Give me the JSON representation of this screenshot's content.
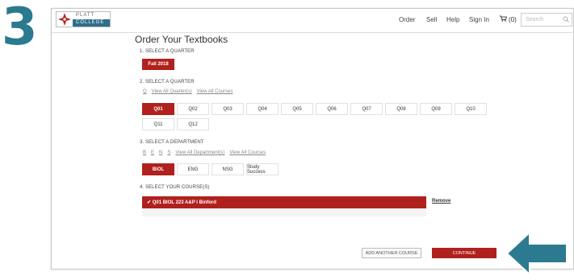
{
  "step_number": "3",
  "header": {
    "logo": {
      "top": "PLATT",
      "bottom": "COLLEGE"
    },
    "nav": {
      "order": "Order",
      "sell": "Sell",
      "help": "Help",
      "sign_in": "Sign In"
    },
    "cart_count": "(0)",
    "search_placeholder": "Search"
  },
  "page_title": "Order Your Textbooks",
  "section1": {
    "label": "1. SELECT A QUARTER",
    "selected": "Fall 2018"
  },
  "section2": {
    "label": "2. SELECT A QUARTER",
    "links": [
      "Q",
      "View All Quarter(s)",
      "View All Courses"
    ],
    "options": [
      "Q01",
      "Q02",
      "Q03",
      "Q04",
      "Q05",
      "Q06",
      "Q07",
      "Q08",
      "Q09",
      "Q10",
      "Q11",
      "Q12"
    ]
  },
  "section3": {
    "label": "3. SELECT A DEPARTMENT",
    "links": [
      "B",
      "E",
      "N",
      "S",
      "View All Department(s)",
      "View All Courses"
    ],
    "options": [
      "BIOL",
      "ENG",
      "NSG",
      "Study Success"
    ]
  },
  "section4": {
    "label": "4. SELECT YOUR COURSE(S)",
    "course": "✔ Q01 BIOL 223  A&P I Binford",
    "remove": "Remove"
  },
  "actions": {
    "add_another": "ADD ANOTHER COURSE",
    "continue": "CONTINUE"
  },
  "colors": {
    "brand_red": "#b0201d",
    "accent_teal": "#2b7a8f"
  }
}
